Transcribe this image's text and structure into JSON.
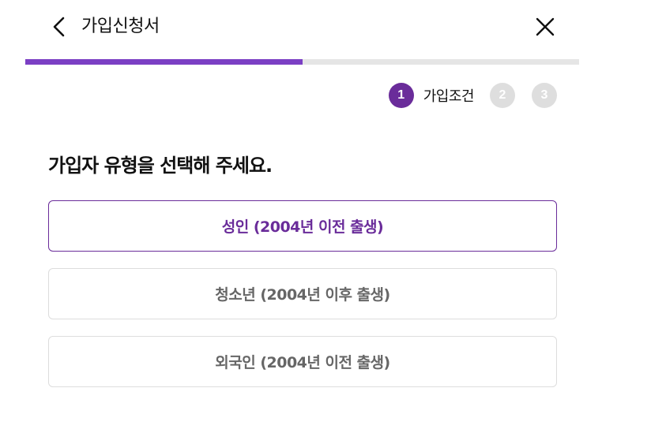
{
  "header": {
    "title": "가입신청서",
    "back_icon": "chevron-left-icon",
    "close_icon": "close-icon"
  },
  "progress": {
    "percent": 50,
    "fill_color": "#7b3fc4",
    "track_color": "#e5e5e5"
  },
  "steps": [
    {
      "number": "1",
      "label": "가입조건",
      "active": true
    },
    {
      "number": "2",
      "active": false
    },
    {
      "number": "3",
      "active": false
    }
  ],
  "question": "가입자 유형을 선택해 주세요.",
  "options": [
    {
      "label": "성인 (2004년 이전 출생)",
      "selected": true
    },
    {
      "label": "청소년 (2004년 이후 출생)",
      "selected": false
    },
    {
      "label": "외국인 (2004년 이전 출생)",
      "selected": false
    }
  ],
  "colors": {
    "accent": "#6a2c9a",
    "inactive_step": "#dedede",
    "option_border": "#dddddd",
    "option_text": "#666666"
  }
}
